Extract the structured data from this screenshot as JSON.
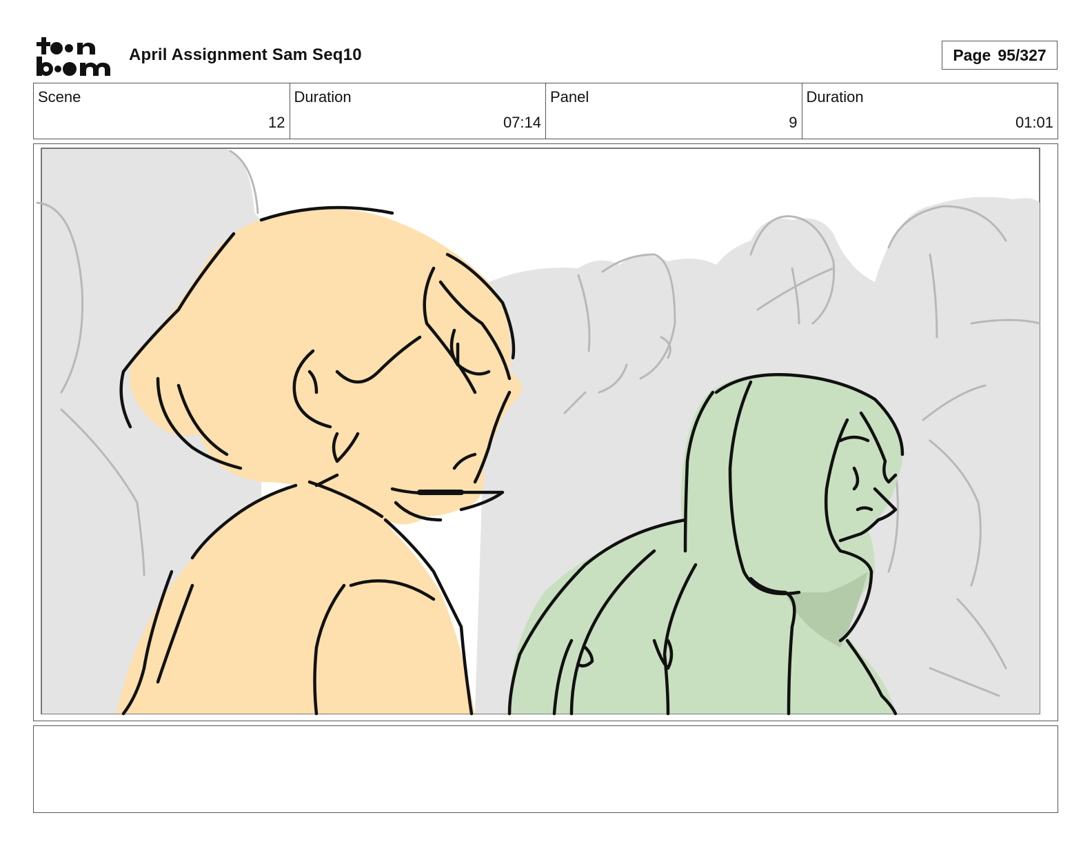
{
  "header": {
    "logo_text": "toon boom",
    "title": "April Assignment Sam Seq10",
    "page_label": "Page",
    "page_value": "95/327"
  },
  "info": {
    "scene_label": "Scene",
    "scene_value": "12",
    "scene_duration_label": "Duration",
    "scene_duration_value": "07:14",
    "panel_label": "Panel",
    "panel_value": "9",
    "panel_duration_label": "Duration",
    "panel_duration_value": "01:01"
  },
  "panel": {
    "colors": {
      "background_crowd": "#e4e4e4",
      "crowd_lines": "#b8b8b8",
      "character_left_fill": "#fde0ad",
      "character_right_fill": "#c9e0c0",
      "character_right_shadow": "#b3cba9",
      "ink": "#111111"
    }
  },
  "notes": {
    "text": ""
  }
}
